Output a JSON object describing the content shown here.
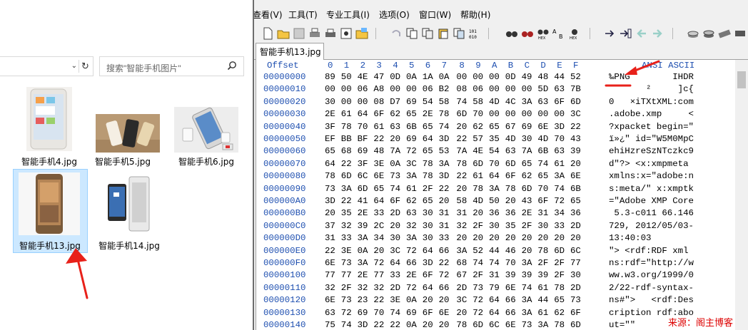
{
  "explorer": {
    "search_placeholder": "搜索\"智能手机图片\"",
    "files": [
      {
        "name": "智能手机4.jpg"
      },
      {
        "name": "智能手机5.jpg"
      },
      {
        "name": "智能手机6.jpg"
      },
      {
        "name": "智能手机13.jpg",
        "selected": true
      },
      {
        "name": "智能手机14.jpg"
      }
    ]
  },
  "hex_editor": {
    "menu": [
      "查看(V)",
      "工具(T)",
      "专业工具(I)",
      "选项(O)",
      "窗口(W)",
      "帮助(H)"
    ],
    "toolbar_icons": [
      "new-file-icon",
      "open-folder-icon",
      "save-icon",
      "print-icon",
      "print-preview-icon",
      "properties-icon",
      "open-folder2-icon",
      "undo-icon",
      "copy-icon",
      "paste-icon",
      "paste-special-icon",
      "hex-copy-icon",
      "binary-icon",
      "find-icon",
      "find-next-icon",
      "find-hex-icon",
      "replace-icon",
      "replace-hex-icon",
      "goto-icon",
      "goto-offset-icon",
      "back-icon",
      "forward-icon",
      "disk-icon",
      "disk2-icon",
      "ram-icon",
      "extra-icon"
    ],
    "tab_label": "智能手机13.jpg",
    "header": {
      "offset_label": "Offset",
      "columns": [
        "0",
        "1",
        "2",
        "3",
        "4",
        "5",
        "6",
        "7",
        "8",
        "9",
        "A",
        "B",
        "C",
        "D",
        "E",
        "F"
      ],
      "ansi_label": "ANSI ASCII"
    },
    "rows": [
      {
        "offset": "00000000",
        "bytes": [
          "89",
          "50",
          "4E",
          "47",
          "0D",
          "0A",
          "1A",
          "0A",
          "00",
          "00",
          "00",
          "0D",
          "49",
          "48",
          "44",
          "52"
        ],
        "ascii": "‰PNG        IHDR"
      },
      {
        "offset": "00000010",
        "bytes": [
          "00",
          "00",
          "06",
          "A8",
          "00",
          "00",
          "06",
          "B2",
          "08",
          "06",
          "00",
          "00",
          "00",
          "5D",
          "63",
          "7B"
        ],
        "ascii": "   ¨   ²     ]c{"
      },
      {
        "offset": "00000020",
        "bytes": [
          "30",
          "00",
          "00",
          "08",
          "D7",
          "69",
          "54",
          "58",
          "74",
          "58",
          "4D",
          "4C",
          "3A",
          "63",
          "6F",
          "6D"
        ],
        "ascii": "0   ×iTXtXML:com"
      },
      {
        "offset": "00000030",
        "bytes": [
          "2E",
          "61",
          "64",
          "6F",
          "62",
          "65",
          "2E",
          "78",
          "6D",
          "70",
          "00",
          "00",
          "00",
          "00",
          "00",
          "3C"
        ],
        "ascii": ".adobe.xmp     <"
      },
      {
        "offset": "00000040",
        "bytes": [
          "3F",
          "78",
          "70",
          "61",
          "63",
          "6B",
          "65",
          "74",
          "20",
          "62",
          "65",
          "67",
          "69",
          "6E",
          "3D",
          "22"
        ],
        "ascii": "?xpacket begin=\""
      },
      {
        "offset": "00000050",
        "bytes": [
          "EF",
          "BB",
          "BF",
          "22",
          "20",
          "69",
          "64",
          "3D",
          "22",
          "57",
          "35",
          "4D",
          "30",
          "4D",
          "70",
          "43"
        ],
        "ascii": "ï»¿\" id=\"W5M0MpC"
      },
      {
        "offset": "00000060",
        "bytes": [
          "65",
          "68",
          "69",
          "48",
          "7A",
          "72",
          "65",
          "53",
          "7A",
          "4E",
          "54",
          "63",
          "7A",
          "6B",
          "63",
          "39"
        ],
        "ascii": "ehiHzreSzNTczkc9"
      },
      {
        "offset": "00000070",
        "bytes": [
          "64",
          "22",
          "3F",
          "3E",
          "0A",
          "3C",
          "78",
          "3A",
          "78",
          "6D",
          "70",
          "6D",
          "65",
          "74",
          "61",
          "20"
        ],
        "ascii": "d\"?> <x:xmpmeta "
      },
      {
        "offset": "00000080",
        "bytes": [
          "78",
          "6D",
          "6C",
          "6E",
          "73",
          "3A",
          "78",
          "3D",
          "22",
          "61",
          "64",
          "6F",
          "62",
          "65",
          "3A",
          "6E"
        ],
        "ascii": "xmlns:x=\"adobe:n"
      },
      {
        "offset": "00000090",
        "bytes": [
          "73",
          "3A",
          "6D",
          "65",
          "74",
          "61",
          "2F",
          "22",
          "20",
          "78",
          "3A",
          "78",
          "6D",
          "70",
          "74",
          "6B"
        ],
        "ascii": "s:meta/\" x:xmptk"
      },
      {
        "offset": "000000A0",
        "bytes": [
          "3D",
          "22",
          "41",
          "64",
          "6F",
          "62",
          "65",
          "20",
          "58",
          "4D",
          "50",
          "20",
          "43",
          "6F",
          "72",
          "65"
        ],
        "ascii": "=\"Adobe XMP Core"
      },
      {
        "offset": "000000B0",
        "bytes": [
          "20",
          "35",
          "2E",
          "33",
          "2D",
          "63",
          "30",
          "31",
          "31",
          "20",
          "36",
          "36",
          "2E",
          "31",
          "34",
          "36"
        ],
        "ascii": " 5.3-c011 66.146"
      },
      {
        "offset": "000000C0",
        "bytes": [
          "37",
          "32",
          "39",
          "2C",
          "20",
          "32",
          "30",
          "31",
          "32",
          "2F",
          "30",
          "35",
          "2F",
          "30",
          "33",
          "2D"
        ],
        "ascii": "729, 2012/05/03-"
      },
      {
        "offset": "000000D0",
        "bytes": [
          "31",
          "33",
          "3A",
          "34",
          "30",
          "3A",
          "30",
          "33",
          "20",
          "20",
          "20",
          "20",
          "20",
          "20",
          "20",
          "20"
        ],
        "ascii": "13:40:03        "
      },
      {
        "offset": "000000E0",
        "bytes": [
          "22",
          "3E",
          "0A",
          "20",
          "3C",
          "72",
          "64",
          "66",
          "3A",
          "52",
          "44",
          "46",
          "20",
          "78",
          "6D",
          "6C"
        ],
        "ascii": "\"> <rdf:RDF xml"
      },
      {
        "offset": "000000F0",
        "bytes": [
          "6E",
          "73",
          "3A",
          "72",
          "64",
          "66",
          "3D",
          "22",
          "68",
          "74",
          "74",
          "70",
          "3A",
          "2F",
          "2F",
          "77"
        ],
        "ascii": "ns:rdf=\"http://w"
      },
      {
        "offset": "00000100",
        "bytes": [
          "77",
          "77",
          "2E",
          "77",
          "33",
          "2E",
          "6F",
          "72",
          "67",
          "2F",
          "31",
          "39",
          "39",
          "39",
          "2F",
          "30"
        ],
        "ascii": "ww.w3.org/1999/0"
      },
      {
        "offset": "00000110",
        "bytes": [
          "32",
          "2F",
          "32",
          "32",
          "2D",
          "72",
          "64",
          "66",
          "2D",
          "73",
          "79",
          "6E",
          "74",
          "61",
          "78",
          "2D"
        ],
        "ascii": "2/22-rdf-syntax-"
      },
      {
        "offset": "00000120",
        "bytes": [
          "6E",
          "73",
          "23",
          "22",
          "3E",
          "0A",
          "20",
          "20",
          "3C",
          "72",
          "64",
          "66",
          "3A",
          "44",
          "65",
          "73"
        ],
        "ascii": "ns#\">   <rdf:Des"
      },
      {
        "offset": "00000130",
        "bytes": [
          "63",
          "72",
          "69",
          "70",
          "74",
          "69",
          "6F",
          "6E",
          "20",
          "72",
          "64",
          "66",
          "3A",
          "61",
          "62",
          "6F"
        ],
        "ascii": "cription rdf:abo"
      },
      {
        "offset": "00000140",
        "bytes": [
          "75",
          "74",
          "3D",
          "22",
          "22",
          "0A",
          "20",
          "20",
          "78",
          "6D",
          "6C",
          "6E",
          "73",
          "3A",
          "78",
          "6D"
        ],
        "ascii": "ut=\"\"      "
      }
    ]
  },
  "watermark": "来源：阁主博客",
  "colors": {
    "offset_blue": "#1e4fb0",
    "annotation_red": "#e8211a",
    "selection": "#cce8ff"
  }
}
